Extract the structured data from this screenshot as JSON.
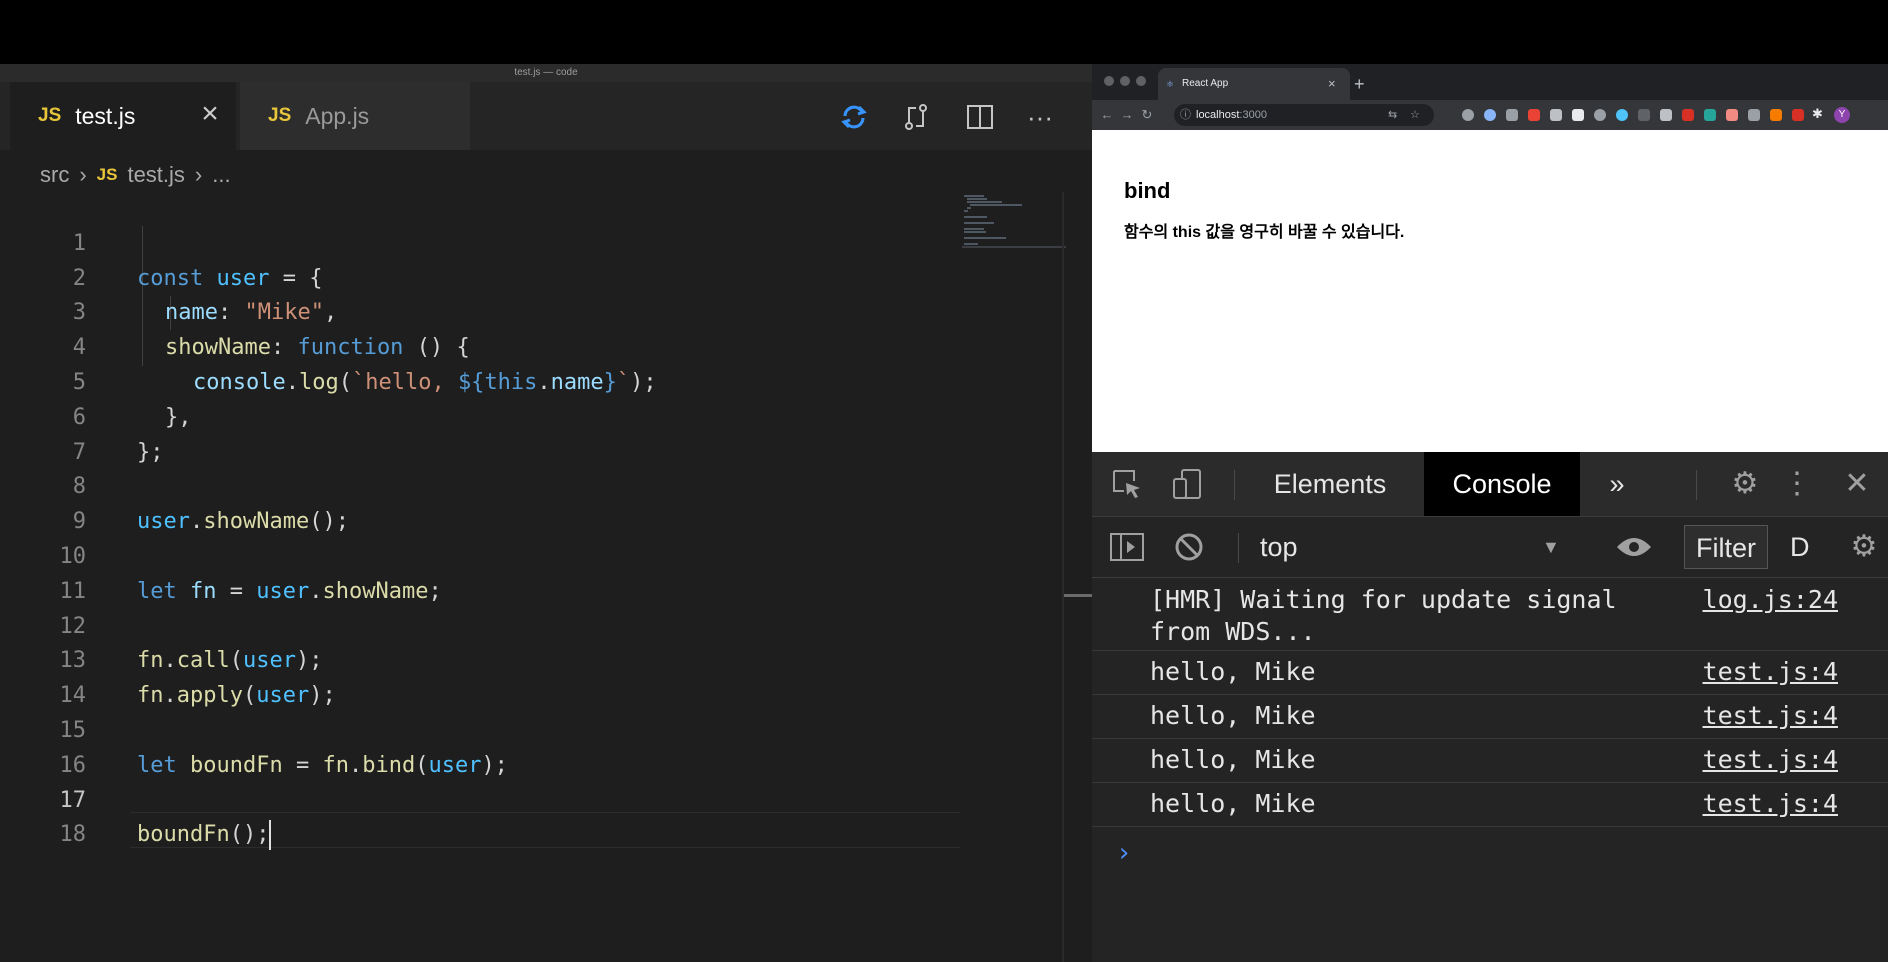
{
  "vscode": {
    "window_title": "test.js — code",
    "tabs": [
      {
        "icon": "JS",
        "label": "test.js"
      },
      {
        "icon": "JS",
        "label": "App.js"
      }
    ],
    "breadcrumb": {
      "folder": "src",
      "icon": "JS",
      "file": "test.js",
      "more": "..."
    },
    "toolbar": {
      "sync": "sync-changes-icon",
      "compare": "compare-changes-icon",
      "split": "split-editor-icon",
      "more": "more-actions-icon"
    },
    "code_lines": [
      {
        "n": "1"
      },
      {
        "n": "2"
      },
      {
        "n": "3"
      },
      {
        "n": "4"
      },
      {
        "n": "5"
      },
      {
        "n": "6"
      },
      {
        "n": "7"
      },
      {
        "n": "8"
      },
      {
        "n": "9"
      },
      {
        "n": "10"
      },
      {
        "n": "11"
      },
      {
        "n": "12"
      },
      {
        "n": "13"
      },
      {
        "n": "14"
      },
      {
        "n": "15"
      },
      {
        "n": "16"
      },
      {
        "n": "17"
      },
      {
        "n": "18"
      }
    ],
    "tokens": {
      "l1": [
        "const",
        "user",
        "=",
        "{"
      ],
      "l2": [
        "name",
        ":",
        "\"Mike\"",
        ","
      ],
      "l3": [
        "showName",
        ":",
        "function",
        "()",
        "{"
      ],
      "l4": [
        "console",
        ".",
        "log",
        "(",
        "`hello, ",
        "${",
        "this",
        ".",
        "name",
        "}",
        "`",
        ");"
      ],
      "l5": [
        "},"
      ],
      "l6": [
        "};"
      ],
      "l8": [
        "user",
        ".",
        "showName",
        "();"
      ],
      "l10": [
        "let",
        "fn",
        "=",
        "user",
        ".",
        "showName",
        ";"
      ],
      "l12": [
        "fn",
        ".",
        "call",
        "(",
        "user",
        ");"
      ],
      "l13": [
        "fn",
        ".",
        "apply",
        "(",
        "user",
        ");"
      ],
      "l15": [
        "let",
        "boundFn",
        "=",
        "fn",
        ".",
        "bind",
        "(",
        "user",
        ");"
      ],
      "l17": [
        "boundFn",
        "();"
      ]
    }
  },
  "browser": {
    "tab_title": "React App",
    "tab_close": "×",
    "new_tab": "+",
    "url_host": "localhost",
    "url_port": ":3000",
    "page": {
      "heading": "bind",
      "paragraph": "함수의 this 값을 영구히 바꿀 수 있습니다."
    }
  },
  "devtools": {
    "tabs": {
      "elements": "Elements",
      "console": "Console",
      "more": "»"
    },
    "context": "top",
    "filter": "Filter",
    "levels": "D",
    "messages": [
      {
        "text": "[HMR] Waiting for update signal from WDS...",
        "source": "log.js:24"
      },
      {
        "text": "hello, Mike",
        "source": "test.js:4"
      },
      {
        "text": "hello, Mike",
        "source": "test.js:4"
      },
      {
        "text": "hello, Mike",
        "source": "test.js:4"
      },
      {
        "text": "hello, Mike",
        "source": "test.js:4"
      }
    ],
    "prompt": "›"
  },
  "colors": {
    "keyword": "#569cd6",
    "variable": "#4fc1ff",
    "property": "#9cdcfe",
    "function": "#dcdcaa",
    "string": "#ce9178",
    "js_icon": "#e8c53a"
  }
}
